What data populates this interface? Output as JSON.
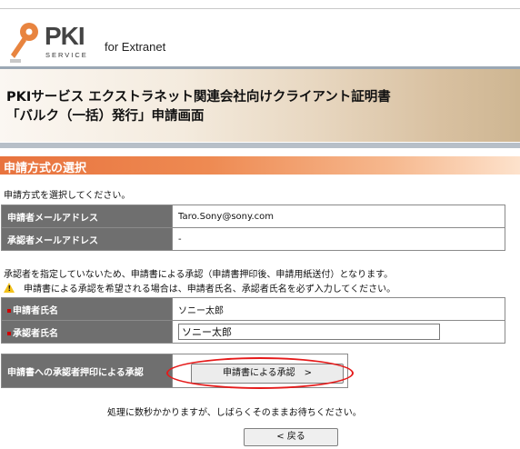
{
  "header": {
    "logo_text": "PKI",
    "logo_subtext": "SERVICE",
    "tagline": "for Extranet",
    "title_line1": "PKIサービス エクストラネット関連会社向けクライアント証明書",
    "title_line2": "「バルク（一括）発行」申請画面"
  },
  "section": {
    "heading": "申請方式の選択",
    "instruction": "申請方式を選択してください。"
  },
  "info_table": {
    "rows": [
      {
        "label": "申請者メールアドレス",
        "value": "Taro.Sony@sony.com"
      },
      {
        "label": "承認者メールアドレス",
        "value": "-"
      }
    ]
  },
  "notes": {
    "line1": "承認者を指定していないため、申請書による承認（申請書押印後、申請用紙送付）となります。",
    "line2": "申請書による承認を希望される場合は、申請者氏名、承認者氏名を必ず入力してください。",
    "warning_icon": "warning-triangle-icon"
  },
  "names_table": {
    "applicant_label": "申請者氏名",
    "applicant_value": "ソニー太郎",
    "approver_label": "承認者氏名",
    "approver_value": "ソニー太郎"
  },
  "approval": {
    "label": "申請書への承認者押印による承認",
    "button_label": "申請書による承認　>"
  },
  "footer": {
    "wait_text": "処理に数秒かかりますが、しばらくそのままお待ちください。",
    "back_label": "< 戻る"
  },
  "colors": {
    "section_bar": "#e8733e",
    "label_cell": "#6f6f6f",
    "highlight_ellipse": "#e51b1b",
    "required_marker": "#d00000"
  }
}
